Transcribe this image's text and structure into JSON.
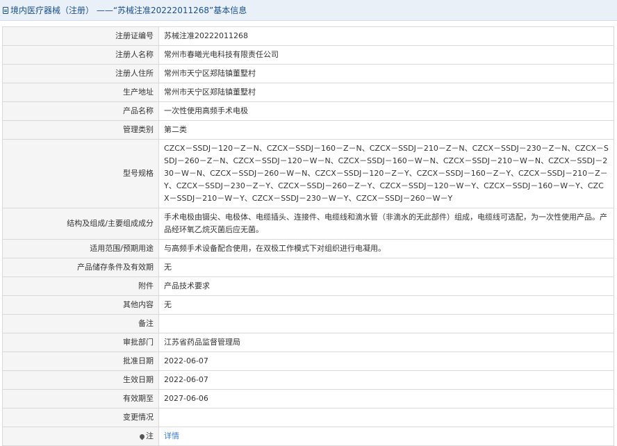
{
  "header": {
    "title": "境内医疗器械（注册） ——“苏械注准20222011268”基本信息",
    "icon": "document-icon"
  },
  "rows": [
    {
      "label": "注册证编号",
      "value": "苏械注准20222011268"
    },
    {
      "label": "注册人名称",
      "value": "常州市春曦光电科技有限责任公司"
    },
    {
      "label": "注册人住所",
      "value": "常州市天宁区郑陆镇董墅村"
    },
    {
      "label": "生产地址",
      "value": "常州市天宁区郑陆镇董墅村"
    },
    {
      "label": "产品名称",
      "value": "一次性使用高频手术电极"
    },
    {
      "label": "管理类别",
      "value": "第二类"
    },
    {
      "label": "型号规格",
      "value": "CZCX－SSDJ－120－Z－N、CZCX－SSDJ－160－Z－N、CZCX－SSDJ－210－Z－N、CZCX－SSDJ－230－Z－N、CZCX－SSDJ－260－Z－N、CZCX－SSDJ－120－W－N、CZCX－SSDJ－160－W－N、CZCX－SSDJ－210－W－N、CZCX－SSDJ－230－W－N、CZCX－SSDJ－260－W－N、CZCX－SSDJ－120－Z－Y、CZCX－SSDJ－160－Z－Y、CZCX－SSDJ－210－Z－Y、CZCX－SSDJ－230－Z－Y、CZCX－SSDJ－260－Z－Y、CZCX－SSDJ－120－W－Y、CZCX－SSDJ－160－W－Y、CZCX－SSDJ－210－W－Y、CZCX－SSDJ－230－W－Y、CZCX－SSDJ－260－W－Y"
    },
    {
      "label": "结构及组成/主要组成成分",
      "value": "手术电极由镊尖、电极体、电缆插头、连接件、电缆线和滴水管（非滴水的无此部件）组成，电缆线可选配，为一次性使用产品。产品经环氧乙烷灭菌后应无菌。"
    },
    {
      "label": "适用范围/预期用途",
      "value": "与高频手术设备配合使用，在双极工作模式下对组织进行电凝用。"
    },
    {
      "label": "产品储存条件及有效期",
      "value": "无"
    },
    {
      "label": "附件",
      "value": "产品技术要求"
    },
    {
      "label": "其他内容",
      "value": "无"
    },
    {
      "label": "备注",
      "value": ""
    },
    {
      "label": "审批部门",
      "value": "江苏省药品监督管理局"
    },
    {
      "label": "批准日期",
      "value": "2022-06-07"
    },
    {
      "label": "生效日期",
      "value": "2022-06-07"
    },
    {
      "label": "有效期至",
      "value": "2027-06-06"
    },
    {
      "label": "变更情况",
      "value": ""
    }
  ],
  "note": {
    "label": "注",
    "icon": "pin-icon",
    "link_text": "详情",
    "link_color": "#3a7bd5"
  }
}
